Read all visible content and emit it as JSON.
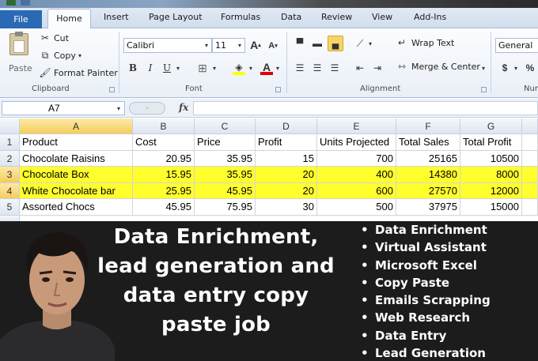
{
  "ribbon_tabs": {
    "file": "File",
    "home": "Home",
    "insert": "Insert",
    "page_layout": "Page Layout",
    "formulas": "Formulas",
    "data": "Data",
    "review": "Review",
    "view": "View",
    "addins": "Add-Ins"
  },
  "clipboard": {
    "paste": "Paste",
    "cut": "Cut",
    "copy": "Copy",
    "format_painter": "Format Painter",
    "group_label": "Clipboard"
  },
  "font": {
    "name": "Calibri",
    "size": "11",
    "bold": "B",
    "italic": "I",
    "underline": "U",
    "group_label": "Font"
  },
  "alignment": {
    "wrap_text": "Wrap Text",
    "merge_center": "Merge & Center",
    "group_label": "Alignment"
  },
  "number": {
    "format": "General",
    "currency": "$",
    "percent": "%",
    "group_label_partial": "Nur"
  },
  "formula_bar": {
    "name_box": "A7",
    "fx": "fx"
  },
  "columns": [
    "A",
    "B",
    "C",
    "D",
    "E",
    "F",
    "G"
  ],
  "rows": [
    "1",
    "2",
    "3",
    "4",
    "5"
  ],
  "table": [
    [
      "Product",
      "Cost",
      "Price",
      "Profit",
      "Units Projected",
      "Total Sales",
      "Total Profit"
    ],
    [
      "Chocolate Raisins",
      "20.95",
      "35.95",
      "15",
      "700",
      "25165",
      "10500"
    ],
    [
      "Chocolate Box",
      "15.95",
      "35.95",
      "20",
      "400",
      "14380",
      "8000"
    ],
    [
      "White Chocolate bar",
      "25.95",
      "45.95",
      "20",
      "600",
      "27570",
      "12000"
    ],
    [
      "Assorted Chocs",
      "45.95",
      "75.95",
      "30",
      "500",
      "37975",
      "15000"
    ]
  ],
  "highlight_color": "#ffff2e",
  "accent_color": "#2a6ab5",
  "headline": [
    "Data Enrichment,",
    "lead generation and",
    "data entry copy",
    "paste job"
  ],
  "bullets": [
    "Data Enrichment",
    "Virtual Assistant",
    "Microsoft Excel",
    "Copy Paste",
    "Emails Scrapping",
    "Web Research",
    "Data Entry",
    "Lead Generation"
  ]
}
